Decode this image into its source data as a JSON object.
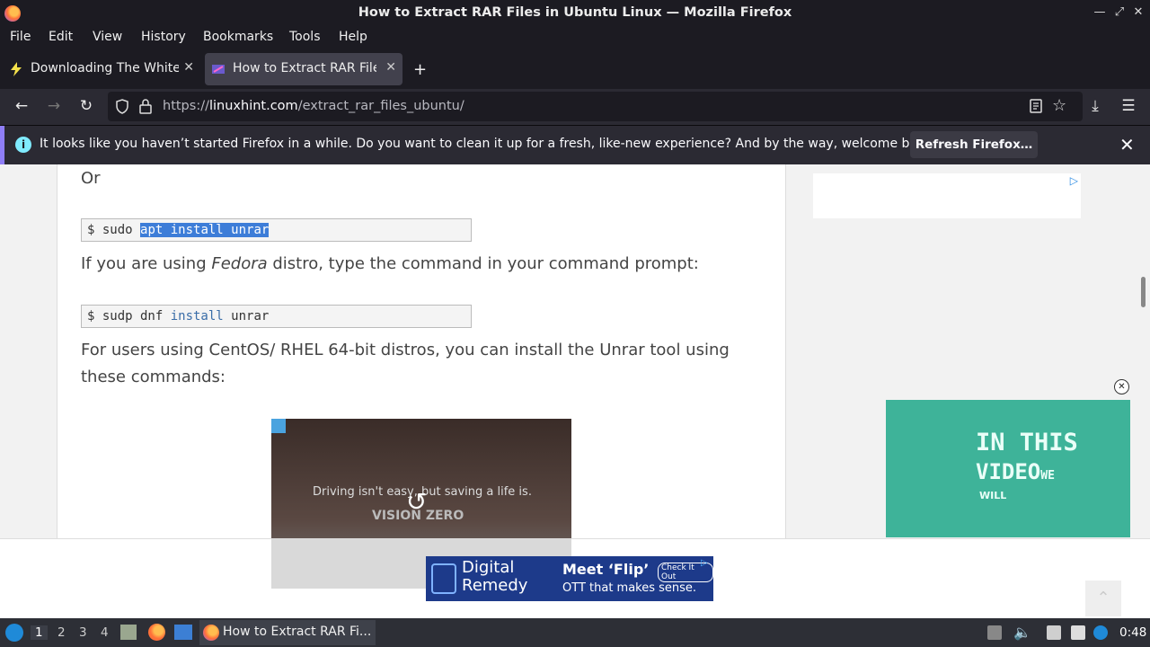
{
  "window": {
    "title": "How to Extract RAR Files in Ubuntu Linux — Mozilla Firefox",
    "min_icon": "minimize-icon",
    "restore_icon": "restore-icon",
    "close_icon": "close-icon"
  },
  "menu": [
    "File",
    "Edit",
    "View",
    "History",
    "Bookmarks",
    "Tools",
    "Help"
  ],
  "tabs": [
    {
      "label": "Downloading The White Ho",
      "active": false
    },
    {
      "label": "How to Extract RAR Files",
      "active": true
    }
  ],
  "nav": {
    "url_prefix": "https://",
    "url_domain": "linuxhint.com",
    "url_path": "/extract_rar_files_ubuntu/"
  },
  "notification": {
    "message": "It looks like you haven’t started Firefox in a while. Do you want to clean it up for a fresh, like-new experience? And by the way, welcome back!",
    "button": "Refresh Firefox…"
  },
  "article": {
    "or_text": "Or",
    "cmd1_prefix": "$ sudo ",
    "cmd1_selected": "apt install unrar",
    "fedora_before": "If you are using ",
    "fedora_em": "Fedora",
    "fedora_after": " distro, type the command in your command prompt:",
    "cmd2_prefix": "$ sudp dnf ",
    "cmd2_kw": "install",
    "cmd2_rest": " unrar",
    "centos_line1": "For users using CentOS/ RHEL 64-bit distros, you can install the Unrar tool using",
    "centos_line2": "these commands:"
  },
  "ads": {
    "video_caption": "Driving isn't easy, but saving a life is.",
    "video_brand": "VISION ZERO",
    "side_line1": "IN THIS",
    "side_line2": "VIDEO",
    "side_line2_small": "WE",
    "side_line3": "WILL",
    "bottom_brand": "Digital\nRemedy",
    "bottom_title": "Meet ‘Flip’",
    "bottom_sub": "OTT that makes sense.",
    "bottom_cta": "Check It Out"
  },
  "taskbar": {
    "workspaces": [
      "1",
      "2",
      "3",
      "4"
    ],
    "active_app": "How to Extract RAR Fi...",
    "clock": "0:48"
  }
}
